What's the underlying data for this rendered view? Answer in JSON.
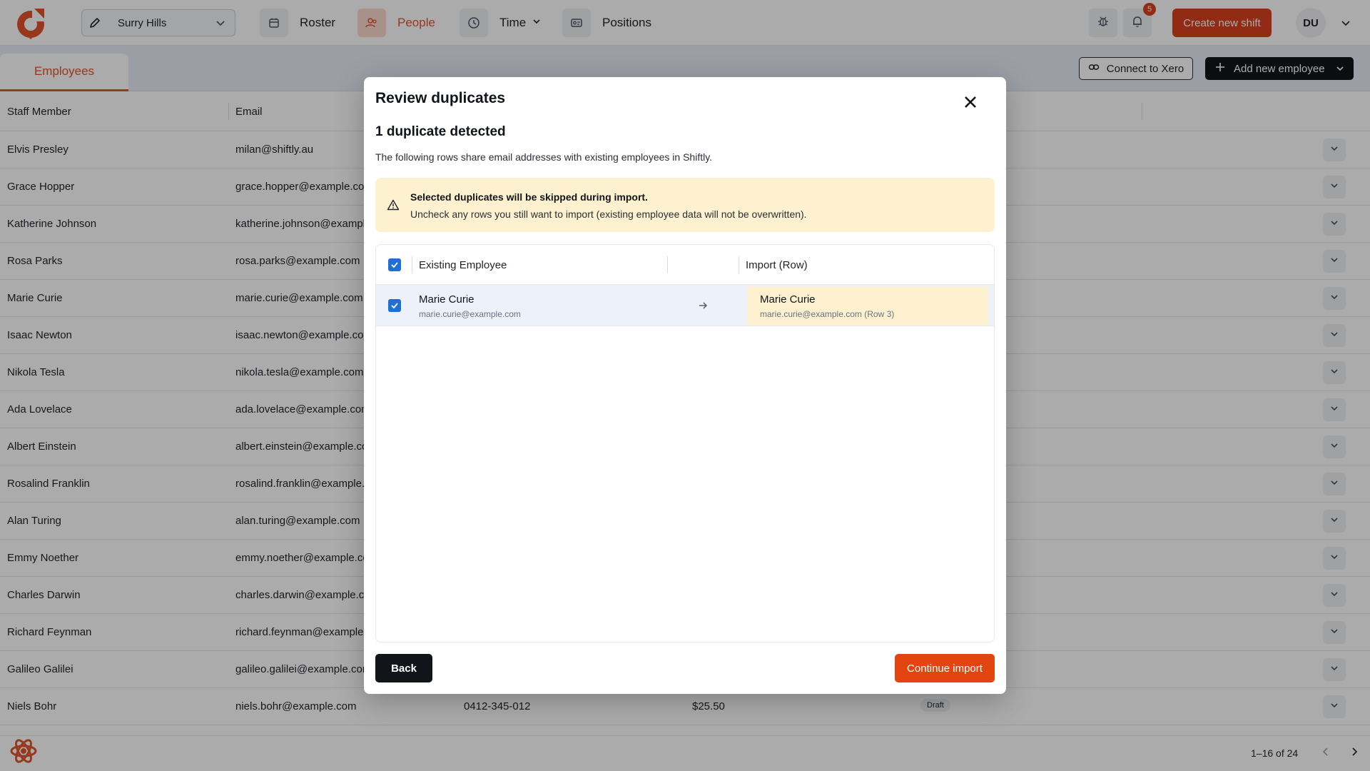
{
  "topbar": {
    "location": "Surry Hills",
    "nav": [
      {
        "label": "Roster",
        "icon": "calendar-icon"
      },
      {
        "label": "People",
        "icon": "people-icon"
      },
      {
        "label": "Time",
        "icon": "clock-icon"
      },
      {
        "label": "Positions",
        "icon": "id-card-icon"
      }
    ],
    "notifications_count": "5",
    "create_shift_label": "Create new shift",
    "avatar_initials": "DU",
    "accent_color": "#d9411e"
  },
  "subbar": {
    "tab_label": "Employees",
    "xero_label": "Connect to Xero",
    "add_employee_label": "Add new employee"
  },
  "table": {
    "headers": [
      "Staff Member",
      "Email"
    ],
    "rows": [
      {
        "name": "Elvis Presley",
        "email": "milan@shiftly.au"
      },
      {
        "name": "Grace Hopper",
        "email": "grace.hopper@example.com"
      },
      {
        "name": "Katherine Johnson",
        "email": "katherine.johnson@example.com"
      },
      {
        "name": "Rosa Parks",
        "email": "rosa.parks@example.com"
      },
      {
        "name": "Marie Curie",
        "email": "marie.curie@example.com"
      },
      {
        "name": "Isaac Newton",
        "email": "isaac.newton@example.com"
      },
      {
        "name": "Nikola Tesla",
        "email": "nikola.tesla@example.com"
      },
      {
        "name": "Ada Lovelace",
        "email": "ada.lovelace@example.com"
      },
      {
        "name": "Albert Einstein",
        "email": "albert.einstein@example.com"
      },
      {
        "name": "Rosalind Franklin",
        "email": "rosalind.franklin@example.com"
      },
      {
        "name": "Alan Turing",
        "email": "alan.turing@example.com"
      },
      {
        "name": "Emmy Noether",
        "email": "emmy.noether@example.com"
      },
      {
        "name": "Charles Darwin",
        "email": "charles.darwin@example.com"
      },
      {
        "name": "Richard Feynman",
        "email": "richard.feynman@example.com"
      },
      {
        "name": "Galileo Galilei",
        "email": "galileo.galilei@example.com"
      },
      {
        "name": "Niels Bohr",
        "email": "niels.bohr@example.com",
        "phone": "0412-345-012",
        "rate": "$25.50",
        "status": "Draft"
      }
    ],
    "pagination": "1–16 of 24"
  },
  "modal": {
    "title": "Review duplicates",
    "heading": "1 duplicate detected",
    "description": "The following rows share email addresses with existing employees in Shiftly.",
    "alert_title": "Selected duplicates will be skipped during import.",
    "alert_body": "Uncheck any rows you still want to import (existing employee data will not be overwritten).",
    "col_existing": "Existing Employee",
    "col_import": "Import (Row)",
    "duplicates": [
      {
        "existing_name": "Marie Curie",
        "existing_email": "marie.curie@example.com",
        "import_name": "Marie Curie",
        "import_email": "marie.curie@example.com (Row 3)",
        "checked": true
      }
    ],
    "back_label": "Back",
    "continue_label": "Continue import"
  }
}
